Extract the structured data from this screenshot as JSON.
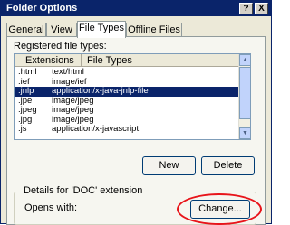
{
  "window": {
    "title": "Folder Options"
  },
  "caption_buttons": {
    "help": "?",
    "close": "X"
  },
  "tabs": [
    {
      "label": "General"
    },
    {
      "label": "View"
    },
    {
      "label": "File Types"
    },
    {
      "label": "Offline Files"
    }
  ],
  "active_tab": "File Types",
  "registered": {
    "label": "Registered file types:",
    "columns": [
      "Extensions",
      "File Types"
    ],
    "rows": [
      {
        "ext": ".html",
        "type": "text/html"
      },
      {
        "ext": ".ief",
        "type": "image/ief"
      },
      {
        "ext": ".jnlp",
        "type": "application/x-java-jnlp-file",
        "selected": true
      },
      {
        "ext": ".jpe",
        "type": "image/jpeg"
      },
      {
        "ext": ".jpeg",
        "type": "image/jpeg"
      },
      {
        "ext": ".jpg",
        "type": "image/jpeg"
      },
      {
        "ext": ".js",
        "type": "application/x-javascript"
      }
    ]
  },
  "buttons": {
    "new": "New",
    "delete": "Delete",
    "change": "Change..."
  },
  "details": {
    "legend": "Details for 'DOC' extension",
    "opens_with": "Opens with:"
  },
  "colors": {
    "titlebar": "#0a246a",
    "selection": "#0a246a",
    "highlight_ring": "#e8141a"
  },
  "icons": [
    "help-icon",
    "close-icon",
    "scroll-up-icon",
    "scroll-down-icon"
  ]
}
